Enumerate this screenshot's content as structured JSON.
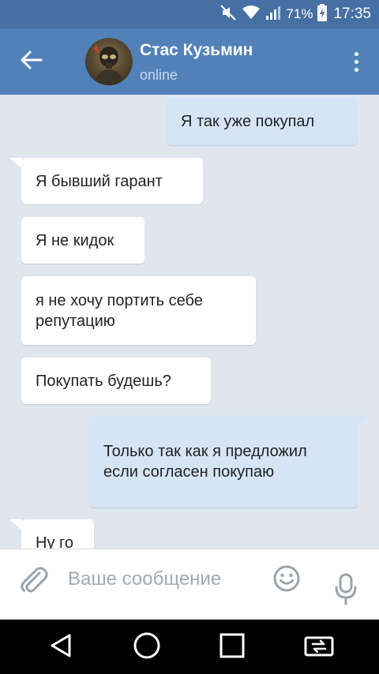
{
  "status_bar": {
    "battery_percent": "71%",
    "time": "17:35"
  },
  "header": {
    "contact_name": "Стас Кузьмин",
    "contact_status": "online"
  },
  "messages": [
    {
      "direction": "out",
      "text": "Я так уже покупал"
    },
    {
      "direction": "in",
      "text": "Я бывший гарант"
    },
    {
      "direction": "in",
      "text": "Я не кидок"
    },
    {
      "direction": "in",
      "text": "я не хочу портить себе репутацию"
    },
    {
      "direction": "in",
      "text": "Покупать будешь?"
    },
    {
      "direction": "out",
      "text": "Только так как я предложил если согласен покупаю"
    },
    {
      "direction": "in",
      "text": "Ну го"
    }
  ],
  "composer": {
    "placeholder": "Ваше сообщение",
    "value": ""
  },
  "icons": {
    "back": "arrow-left-icon",
    "menu": "more-vertical-icon",
    "attach": "paperclip-icon",
    "emoji": "smile-icon",
    "mic": "microphone-icon",
    "nav_back": "triangle-back-icon",
    "nav_home": "circle-home-icon",
    "nav_recents": "square-recents-icon",
    "nav_switch": "switch-app-icon"
  },
  "colors": {
    "status_bar": "#4670a3",
    "header": "#5181b8",
    "chat_background": "#dfe6ee",
    "incoming_bubble": "#ffffff",
    "outgoing_bubble": "#d6e5f6",
    "placeholder": "#a3a9b0"
  }
}
